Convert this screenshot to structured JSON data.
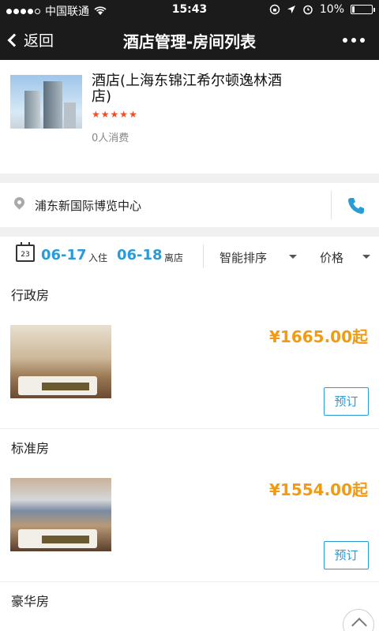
{
  "status_bar": {
    "carrier": "中国联通",
    "time": "15:43",
    "battery": "10%"
  },
  "nav": {
    "back_label": "返回",
    "title": "酒店管理-房间列表"
  },
  "hotel": {
    "name": "酒店(上海东锦江希尔顿逸林酒店)",
    "stars": 5,
    "consumption": "0人消费"
  },
  "location": {
    "address": "浦东新国际博览中心"
  },
  "filter": {
    "checkin_date": "06-17",
    "checkin_label": "入住",
    "checkout_date": "06-18",
    "checkout_label": "离店",
    "calendar_day": "23",
    "sort_label": "智能排序",
    "price_label": "价格"
  },
  "rooms": [
    {
      "name": "行政房",
      "price": "¥1665.00起",
      "book_label": "预订"
    },
    {
      "name": "标准房",
      "price": "¥1554.00起",
      "book_label": "预订"
    },
    {
      "name": "豪华房"
    }
  ],
  "colors": {
    "accent": "#2b9bd8",
    "price": "#f39a13",
    "star": "#f04d24",
    "bar": "#1b1b1b"
  }
}
